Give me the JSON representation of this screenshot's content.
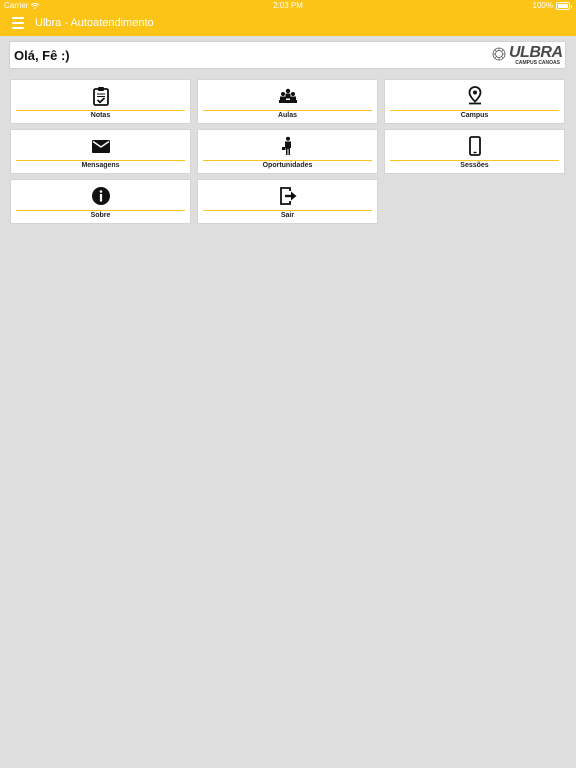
{
  "status_bar": {
    "carrier": "Carrier",
    "time": "2:03 PM",
    "battery": "100%"
  },
  "app_bar": {
    "title": "Ulbra - Autoatendimento"
  },
  "greeting": {
    "text": "Olá, Fê :)"
  },
  "logo": {
    "name": "ULBRA",
    "subtitle": "CAMPUS CANOAS"
  },
  "colors": {
    "accent": "#fcc416",
    "background": "#dedede",
    "tile": "#ffffff"
  },
  "menu": {
    "items": [
      {
        "label": "Notas",
        "icon": "clipboard-check-icon"
      },
      {
        "label": "Aulas",
        "icon": "group-icon"
      },
      {
        "label": "Campus",
        "icon": "map-pin-icon"
      },
      {
        "label": "Mensagens",
        "icon": "envelope-icon"
      },
      {
        "label": "Oportunidades",
        "icon": "businessman-icon"
      },
      {
        "label": "Sessões",
        "icon": "smartphone-icon"
      },
      {
        "label": "Sobre",
        "icon": "info-icon"
      },
      {
        "label": "Sair",
        "icon": "logout-icon"
      }
    ]
  }
}
